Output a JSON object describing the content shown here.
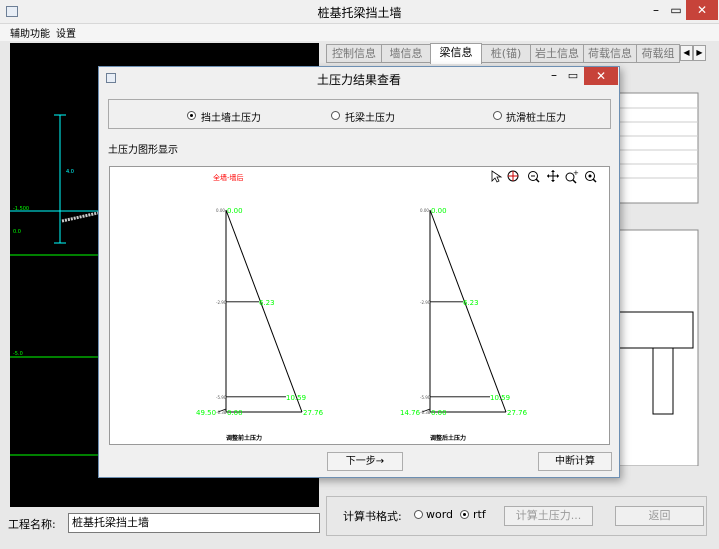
{
  "window": {
    "title": "桩基托梁挡土墙",
    "minimize_icon": "minimize-icon",
    "maximize_icon": "maximize-icon",
    "close_icon": "close-icon"
  },
  "menu": [
    "辅助功能",
    "设置"
  ],
  "tabs": [
    {
      "label": "控制信息",
      "active": false
    },
    {
      "label": "墙信息",
      "active": false
    },
    {
      "label": "梁信息",
      "active": true
    },
    {
      "label": "桩(锚)",
      "active": false
    },
    {
      "label": "岩土信息",
      "active": false
    },
    {
      "label": "荷载信息",
      "active": false
    },
    {
      "label": "荷载组",
      "active": false
    }
  ],
  "bg_canvas_labels": [
    "-1.500",
    "0.0",
    "-5.0",
    "4.0"
  ],
  "bottom": {
    "project_label": "工程名称:",
    "project_value": "桩基托梁挡土墙",
    "format_label": "计算书格式:",
    "format_options": [
      {
        "label": "word",
        "selected": false
      },
      {
        "label": "rtf",
        "selected": true
      }
    ],
    "calc_button": "计算土压力...",
    "return_button": "返回"
  },
  "dialog": {
    "title": "土压力结果查看",
    "options": [
      {
        "label": "挡土墙土压力",
        "selected": true
      },
      {
        "label": "托梁土压力",
        "selected": false
      },
      {
        "label": "抗滑桩土压力",
        "selected": false
      }
    ],
    "figure_label": "土压力图形显示",
    "next_button": "下一步→",
    "stop_button": "中断计算",
    "toolbar_icons": [
      "pointer-icon",
      "zoom-in-icon",
      "zoom-out-icon",
      "pan-icon",
      "zoom-plus-icon",
      "zoom-reset-icon"
    ]
  },
  "chart_data": {
    "type": "area",
    "title": "全墙-墙后",
    "title_color": "#ff0000",
    "value_color": "#00ff00",
    "panels": [
      {
        "caption": "调整前土压力",
        "depth_ticks": [
          "0.00",
          "-2.90",
          "-5.90",
          "-6.38"
        ],
        "depth": [
          0.0,
          -2.9,
          -5.9,
          -6.38
        ],
        "values": [
          "0.00",
          "6.23",
          "10.59",
          "0.00"
        ],
        "base_left": "49.50",
        "base_right": "27.76"
      },
      {
        "caption": "调整后土压力",
        "depth_ticks": [
          "0.00",
          "-2.90",
          "-5.90",
          "-6.38"
        ],
        "depth": [
          0.0,
          -2.9,
          -5.9,
          -6.38
        ],
        "values": [
          "0.00",
          "6.23",
          "10.59",
          "0.00"
        ],
        "base_left": "14.76",
        "base_right": "27.76"
      }
    ]
  }
}
